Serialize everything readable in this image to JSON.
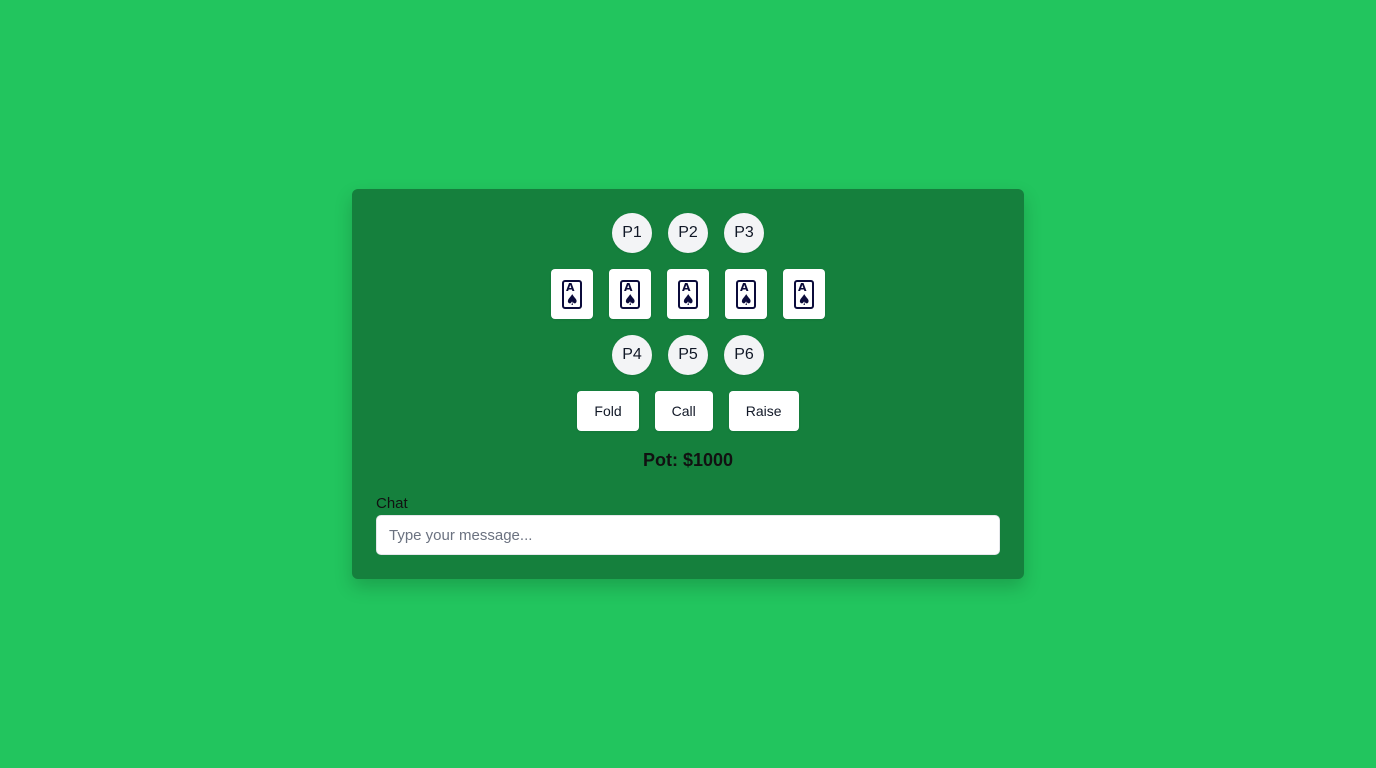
{
  "players_top": [
    {
      "label": "P1"
    },
    {
      "label": "P2"
    },
    {
      "label": "P3"
    }
  ],
  "community_cards": [
    {
      "rank": "A",
      "suit": "♠",
      "icon": "ace-of-spades-icon"
    },
    {
      "rank": "A",
      "suit": "♠",
      "icon": "ace-of-spades-icon"
    },
    {
      "rank": "A",
      "suit": "♠",
      "icon": "ace-of-spades-icon"
    },
    {
      "rank": "A",
      "suit": "♠",
      "icon": "ace-of-spades-icon"
    },
    {
      "rank": "A",
      "suit": "♠",
      "icon": "ace-of-spades-icon"
    }
  ],
  "players_bottom": [
    {
      "label": "P4"
    },
    {
      "label": "P5"
    },
    {
      "label": "P6"
    }
  ],
  "actions": {
    "fold_label": "Fold",
    "call_label": "Call",
    "raise_label": "Raise"
  },
  "pot": {
    "text": "Pot: $1000"
  },
  "chat": {
    "label": "Chat",
    "value": "",
    "placeholder": "Type your message..."
  },
  "colors": {
    "background": "#22c55e",
    "table": "#15803d",
    "card_ink": "#0b0b3b"
  }
}
